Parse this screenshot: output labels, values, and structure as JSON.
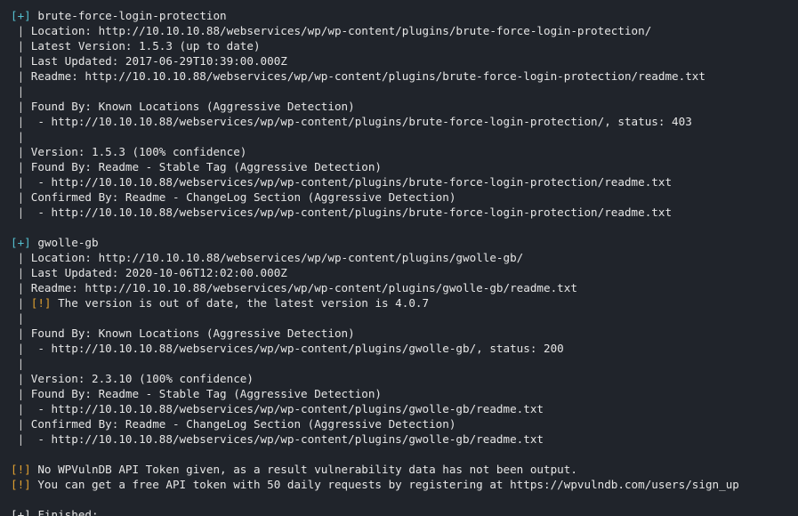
{
  "colors": {
    "background": "#20242b",
    "text": "#e6e6e6",
    "plus_marker": "#55c0d0",
    "warning_marker": "#e0a030"
  },
  "markers": {
    "plus": "[+]",
    "warning": "[!]"
  },
  "plugins": [
    {
      "name": "brute-force-login-protection",
      "lines": [
        "Location: http://10.10.10.88/webservices/wp/wp-content/plugins/brute-force-login-protection/",
        "Latest Version: 1.5.3 (up to date)",
        "Last Updated: 2017-06-29T10:39:00.000Z",
        "Readme: http://10.10.10.88/webservices/wp/wp-content/plugins/brute-force-login-protection/readme.txt",
        "",
        "Found By: Known Locations (Aggressive Detection)",
        " - http://10.10.10.88/webservices/wp/wp-content/plugins/brute-force-login-protection/, status: 403",
        "",
        "Version: 1.5.3 (100% confidence)",
        "Found By: Readme - Stable Tag (Aggressive Detection)",
        " - http://10.10.10.88/webservices/wp/wp-content/plugins/brute-force-login-protection/readme.txt",
        "Confirmed By: Readme - ChangeLog Section (Aggressive Detection)",
        " - http://10.10.10.88/webservices/wp/wp-content/plugins/brute-force-login-protection/readme.txt"
      ]
    },
    {
      "name": "gwolle-gb",
      "location": "Location: http://10.10.10.88/webservices/wp/wp-content/plugins/gwolle-gb/",
      "last_updated": "Last Updated: 2020-10-06T12:02:00.000Z",
      "readme": "Readme: http://10.10.10.88/webservices/wp/wp-content/plugins/gwolle-gb/readme.txt",
      "outdated_warning": " The version is out of date, the latest version is 4.0.7",
      "found_by": "Found By: Known Locations (Aggressive Detection)",
      "found_url": " - http://10.10.10.88/webservices/wp/wp-content/plugins/gwolle-gb/, status: 200",
      "version": "Version: 2.3.10 (100% confidence)",
      "version_found_by": "Found By: Readme - Stable Tag (Aggressive Detection)",
      "version_found_url": " - http://10.10.10.88/webservices/wp/wp-content/plugins/gwolle-gb/readme.txt",
      "confirmed_by": "Confirmed By: Readme - ChangeLog Section (Aggressive Detection)",
      "confirmed_url": " - http://10.10.10.88/webservices/wp/wp-content/plugins/gwolle-gb/readme.txt"
    }
  ],
  "footer_warnings": [
    " No WPVulnDB API Token given, as a result vulnerability data has not been output.",
    " You can get a free API token with 50 daily requests by registering at https://wpvulndb.com/users/sign_up"
  ],
  "truncated_next_line": "[+] Finished: ..."
}
